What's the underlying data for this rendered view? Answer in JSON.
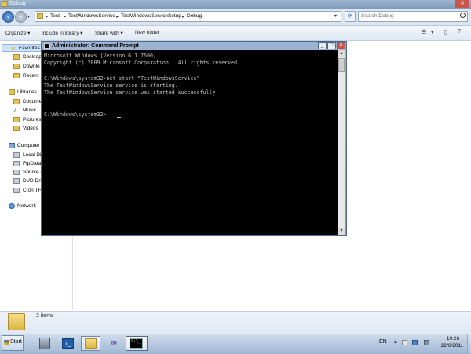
{
  "explorer": {
    "title": "Debug",
    "breadcrumb": [
      "Test",
      "TestWindowsService",
      "TestWindowsServiceSetup",
      "Debug"
    ],
    "search_placeholder": "Search Debug",
    "toolbar": {
      "organize": "Organize",
      "include_in_library": "Include in library",
      "share_with": "Share with",
      "new_folder": "New folder"
    },
    "nav": {
      "favorites": "Favorites",
      "desktop": "Desktop",
      "downloads": "Downlo",
      "recent": "Recent",
      "libraries": "Libraries",
      "documents": "Docume",
      "music": "Music",
      "pictures": "Pictures",
      "videos": "Videos",
      "computer": "Computer",
      "local_disk": "Local Di",
      "ftpdata": "FtpData",
      "source": "Source (",
      "dvd": "DVD Dri",
      "c_on_th": "C on TH",
      "network": "Network"
    },
    "details": {
      "items_count": "2 items"
    }
  },
  "cmd": {
    "title": "Administrator: Command Prompt",
    "lines": [
      "Microsoft Windows [Version 6.1.7600]",
      "Copyright (c) 2009 Microsoft Corporation.  All rights reserved.",
      "",
      "C:\\Windows\\system32>net start \"TestWindowsService\"",
      "The TestWindowsService service is starting.",
      "The TestWindowsService service was started successfully.",
      "",
      "",
      "C:\\Windows\\system32>"
    ]
  },
  "taskbar": {
    "start_label": "Start",
    "cmd_icon_text": "C:\\_",
    "ps_icon_text": "›_",
    "language": "EN",
    "time": "10:26",
    "date": "22/6/2011"
  },
  "colors": {
    "console_bg": "#000000",
    "console_fg": "#c0c0c0",
    "titlebar": "#7f9cbc",
    "close_red": "#c8574b"
  }
}
